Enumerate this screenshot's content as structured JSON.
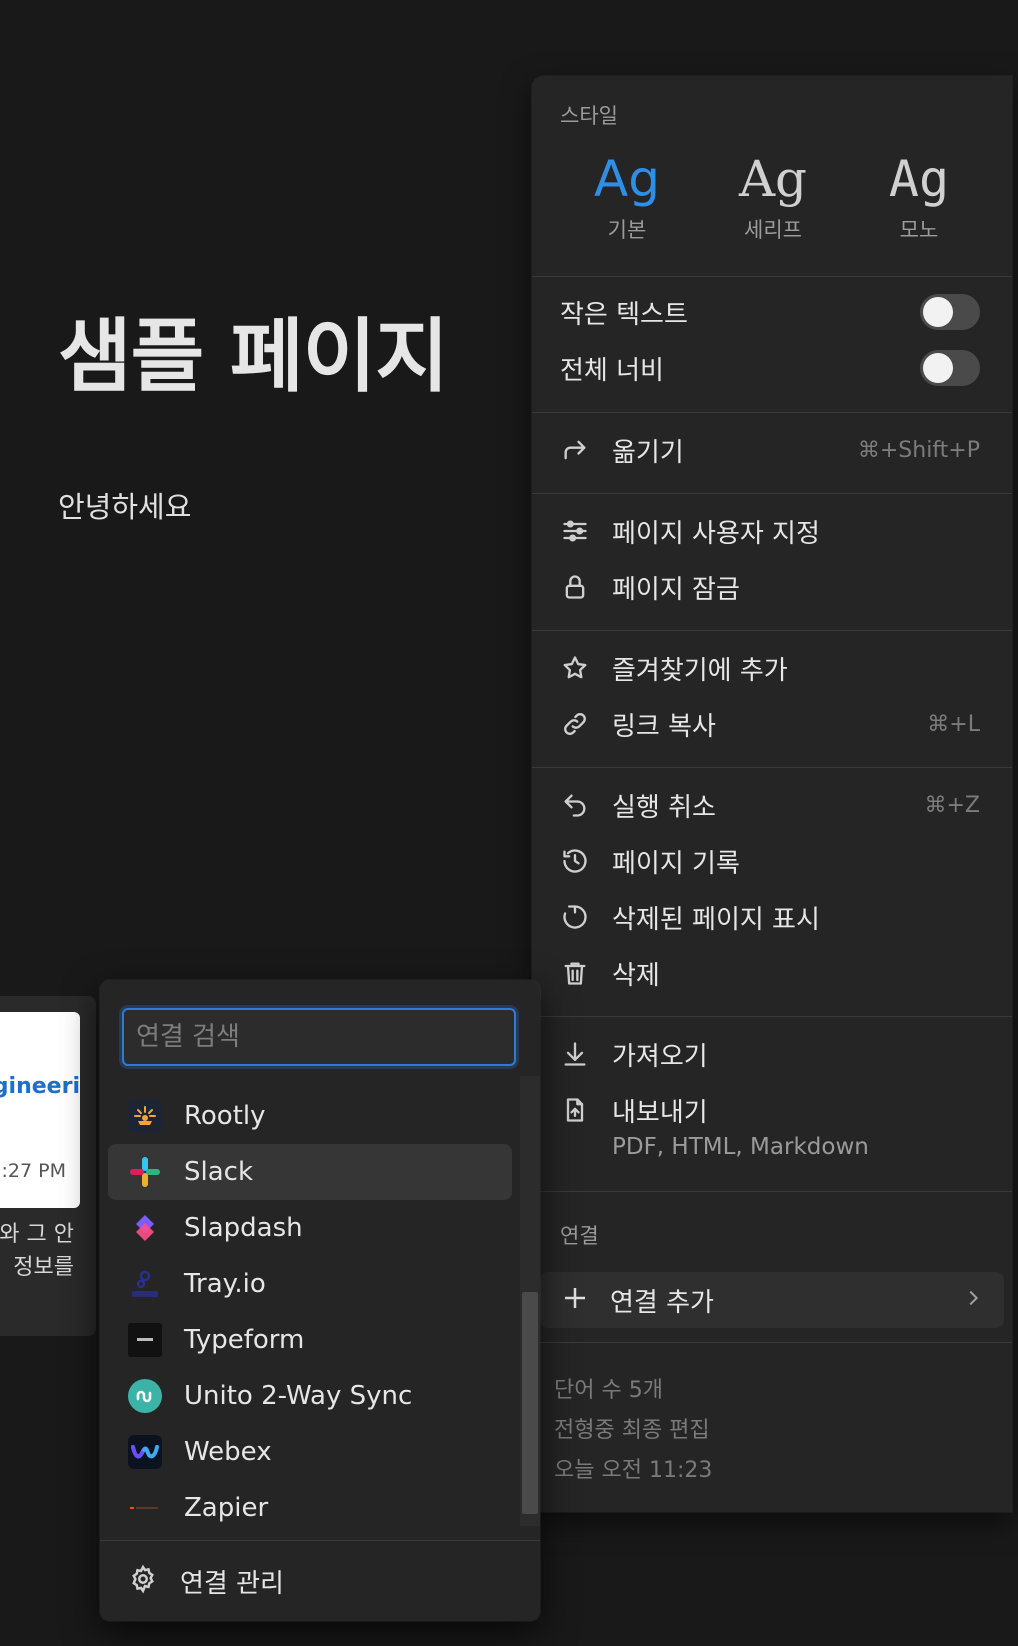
{
  "page": {
    "title": "샘플 페이지",
    "body": "안녕하세요"
  },
  "menu": {
    "style_label": "스타일",
    "styles": [
      {
        "glyph": "Ag",
        "name": "기본",
        "active": true
      },
      {
        "glyph": "Ag",
        "name": "세리프",
        "active": false
      },
      {
        "glyph": "Ag",
        "name": "모노",
        "active": false
      }
    ],
    "small_text_label": "작은 텍스트",
    "small_text_on": false,
    "full_width_label": "전체 너비",
    "full_width_on": false,
    "move": {
      "label": "옮기기",
      "shortcut": "⌘+Shift+P",
      "icon": "move-arrow-icon"
    },
    "customize": {
      "label": "페이지 사용자 지정",
      "icon": "sliders-icon"
    },
    "lock": {
      "label": "페이지 잠금",
      "icon": "lock-icon"
    },
    "favorite": {
      "label": "즐겨찾기에 추가",
      "icon": "star-icon"
    },
    "copy_link": {
      "label": "링크 복사",
      "shortcut": "⌘+L",
      "icon": "link-icon"
    },
    "undo": {
      "label": "실행 취소",
      "shortcut": "⌘+Z",
      "icon": "undo-icon"
    },
    "history": {
      "label": "페이지 기록",
      "icon": "history-icon"
    },
    "show_deleted": {
      "label": "삭제된 페이지 표시",
      "icon": "restore-icon"
    },
    "delete": {
      "label": "삭제",
      "icon": "trash-icon"
    },
    "import": {
      "label": "가져오기",
      "icon": "download-icon"
    },
    "export": {
      "label": "내보내기",
      "sub": "PDF, HTML, Markdown",
      "icon": "export-file-icon"
    },
    "connections_label": "연결",
    "add_connection": {
      "label": "연결 추가",
      "icon": "plus-icon"
    },
    "word_count": "단어 수 5개",
    "last_edited_by": "전형중 최종 편집",
    "last_edited_time": "오늘 오전 11:23"
  },
  "bg_card": {
    "thumb_title": "ngineeri",
    "thumb_time": ":27 PM",
    "line1": "와 그 안",
    "line2": "정보를"
  },
  "connections": {
    "search_placeholder": "연결 검색",
    "search_value": "",
    "items": [
      {
        "name": "Rootly",
        "icon": "rootly-icon"
      },
      {
        "name": "Slack",
        "icon": "slack-icon",
        "highlighted": true
      },
      {
        "name": "Slapdash",
        "icon": "slapdash-icon"
      },
      {
        "name": "Tray.io",
        "icon": "trayio-icon"
      },
      {
        "name": "Typeform",
        "icon": "typeform-icon"
      },
      {
        "name": "Unito 2-Way Sync",
        "icon": "unito-icon"
      },
      {
        "name": "Webex",
        "icon": "webex-icon"
      },
      {
        "name": "Zapier",
        "icon": "zapier-icon"
      }
    ],
    "manage_label": "연결 관리"
  },
  "colors": {
    "background": "#191919",
    "panel": "#252525",
    "accent": "#2e8fe6"
  }
}
